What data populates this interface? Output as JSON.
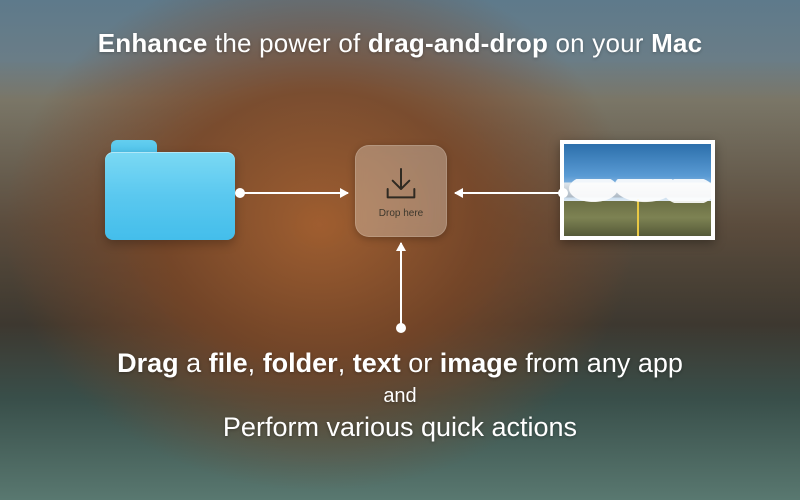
{
  "headline": {
    "w1": "Enhance",
    "t1": " the power of ",
    "w2": "drag-and-drop",
    "t2": " on your ",
    "w3": "Mac"
  },
  "dropzone": {
    "label": "Drop here"
  },
  "sub": {
    "drag": "Drag",
    "t1": " a ",
    "file": "file",
    "c1": ", ",
    "folder": "folder",
    "c2": ", ",
    "text": "text",
    "t2": " or ",
    "image": "image",
    "t3": " from any app",
    "and": "and",
    "line2": "Perform various quick actions"
  }
}
